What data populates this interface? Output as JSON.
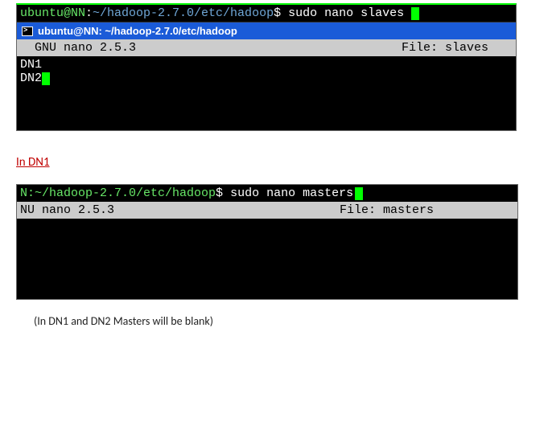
{
  "terminal1": {
    "prompt": {
      "userhost": "ubuntu@NN",
      "path": "~/hadoop-2.7.0/etc/hadoop",
      "dollar": "$",
      "command": "sudo nano slaves"
    },
    "titlebar": "ubuntu@NN: ~/hadoop-2.7.0/etc/hadoop",
    "nano": {
      "version_label": "  GNU nano 2.5.3",
      "file_label": "File: slaves",
      "line1": "DN1",
      "line2": "DN2"
    }
  },
  "section_heading": "In DN1",
  "terminal2": {
    "prompt": {
      "userhost_path": "N:~/hadoop-2.7.0/etc/hadoop",
      "dollar": "$",
      "command": "sudo nano masters"
    },
    "nano": {
      "version_label": "NU nano 2.5.3",
      "file_label": "File: masters"
    }
  },
  "caption": "(In DN1 and DN2 Masters will be blank)"
}
